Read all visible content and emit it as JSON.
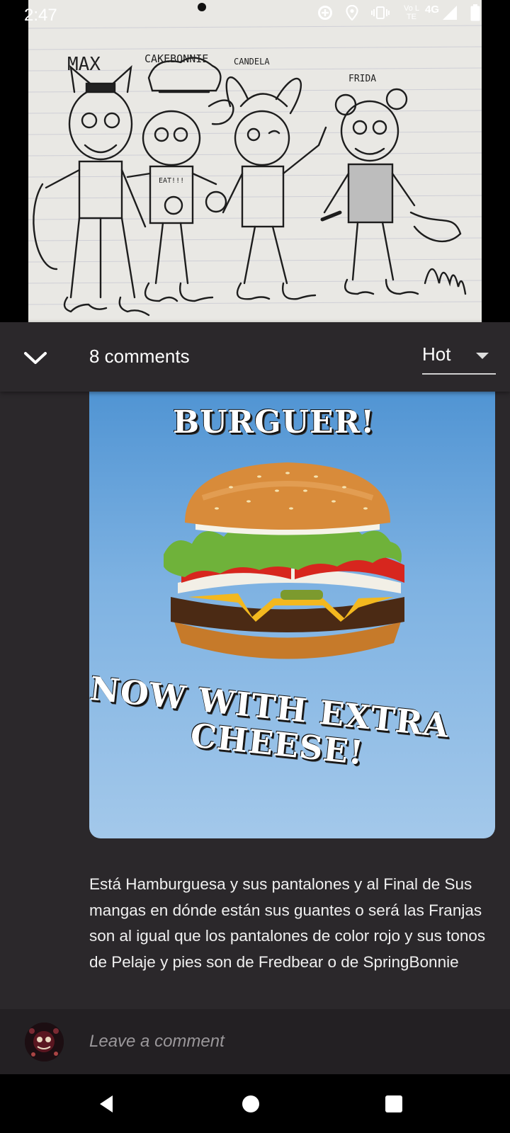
{
  "status_bar": {
    "time": "2:47",
    "network_label": "Vo LTE",
    "network_type": "4G",
    "icons": [
      "data-saver-icon",
      "location-icon",
      "vibrate-icon",
      "signal-icon",
      "battery-icon"
    ]
  },
  "post_image": {
    "characters": [
      "MAX",
      "CAKEBONNIE",
      "CANDELA",
      "FRIDA"
    ],
    "shirt_text": "EAT!!!"
  },
  "comments_header": {
    "count_label": "8 comments",
    "sort_value": "Hot"
  },
  "comment": {
    "image_text_top": "BURGUER!",
    "image_text_bottom_1": "NOW WITH EXTRA",
    "image_text_bottom_2": "CHEESE!",
    "body": "Está Hamburguesa y sus pantalones y al Final de Sus mangas en dónde están sus guantes o será las Franjas son al igual que los pantalones de color rojo y sus tonos de Pelaje y pies son de Fredbear o de SpringBonnie"
  },
  "leave_comment": {
    "placeholder": "Leave a comment"
  },
  "colors": {
    "panel_bg": "#2b282b",
    "input_bar_bg": "#232023",
    "promo_blue": "#4d92d2"
  }
}
